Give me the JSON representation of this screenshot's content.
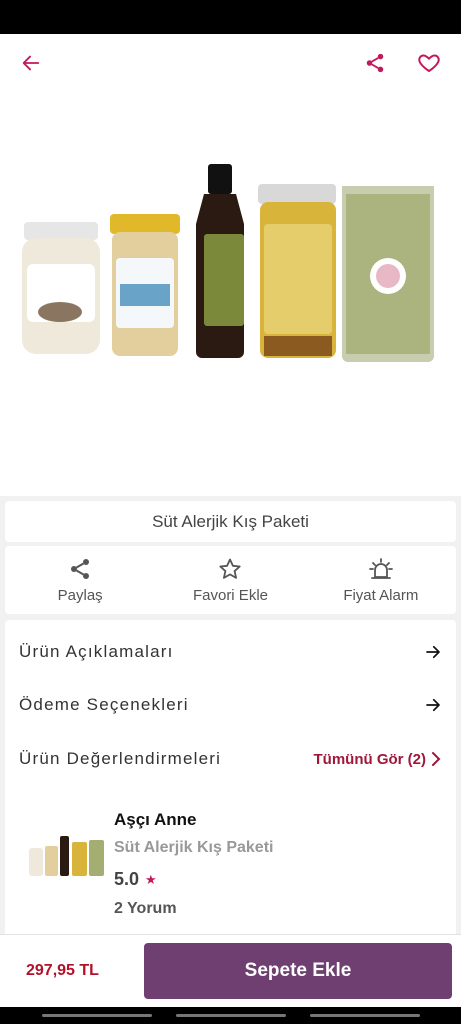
{
  "header": {
    "back_icon": "arrow-left-icon",
    "share_icon": "share-icon",
    "favorite_icon": "heart-outline-icon",
    "accent_color": "#c2185b"
  },
  "product": {
    "title": "Süt Alerjik Kış Paketi"
  },
  "actions": [
    {
      "icon": "share-icon",
      "label": "Paylaş"
    },
    {
      "icon": "star-outline-icon",
      "label": "Favori Ekle"
    },
    {
      "icon": "alarm-icon",
      "label": "Fiyat Alarm"
    }
  ],
  "sections": {
    "descriptions": "Ürün Açıklamaları",
    "payment_options": "Ödeme Seçenekleri",
    "reviews": "Ürün Değerlendirmeleri",
    "see_all": "Tümünü Gör (2)"
  },
  "review_card": {
    "seller": "Aşçı Anne",
    "product_name": "Süt Alerjik Kış Paketi",
    "rating": "5.0",
    "review_count": "2 Yorum"
  },
  "footer": {
    "price": "297,95 TL",
    "add_to_cart": "Sepete Ekle",
    "button_color": "#6f3f72",
    "price_color": "#b0122b"
  }
}
